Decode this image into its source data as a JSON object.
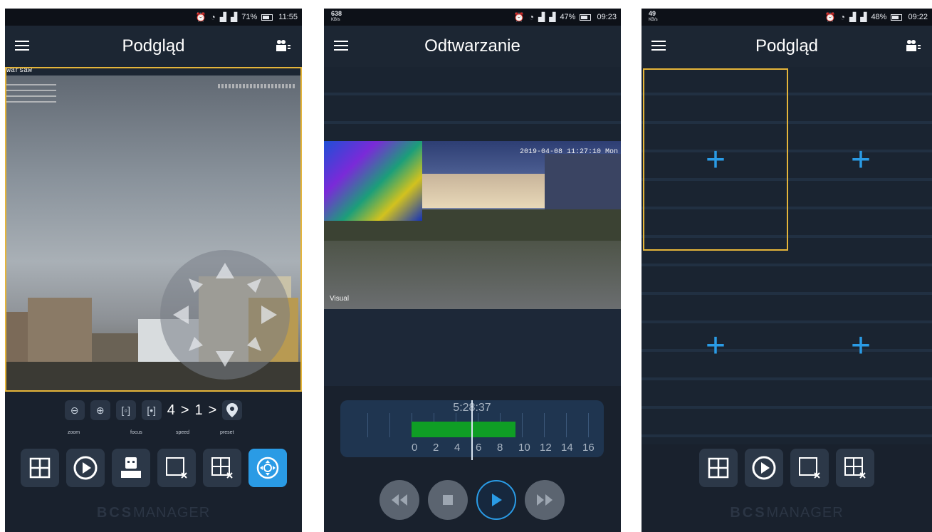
{
  "screens": [
    {
      "status": {
        "battery": "71%",
        "time": "11:55"
      },
      "title": "Podgląd",
      "camera_label": "Warsaw",
      "ptz": {
        "steps": {
          "a": "4",
          "b": "1"
        },
        "labels": {
          "zoom": "zoom",
          "focus": "focus",
          "speed": "speed",
          "preset": "preset"
        }
      },
      "brand": {
        "bold": "BCS",
        "rest": "MANAGER"
      }
    },
    {
      "status": {
        "speed_value": "638",
        "speed_unit": "KB/s",
        "battery": "47%",
        "time": "09:23"
      },
      "title": "Odtwarzanie",
      "overlay": {
        "timestamp": "2019-04-08 11:27:10 Mon",
        "channel": "Visual"
      },
      "timeline": {
        "time": "5:28:37",
        "scale": [
          "0",
          "2",
          "4",
          "6",
          "8",
          "10",
          "12",
          "14",
          "16"
        ]
      }
    },
    {
      "status": {
        "speed_value": "49",
        "speed_unit": "KB/s",
        "battery": "48%",
        "time": "09:22"
      },
      "title": "Podgląd",
      "brand": {
        "bold": "BCS",
        "rest": "MANAGER"
      }
    }
  ],
  "colors": {
    "accent": "#2a9be5",
    "selection": "#e5b53a",
    "recording": "#0f9e25",
    "background": "#19212d"
  }
}
